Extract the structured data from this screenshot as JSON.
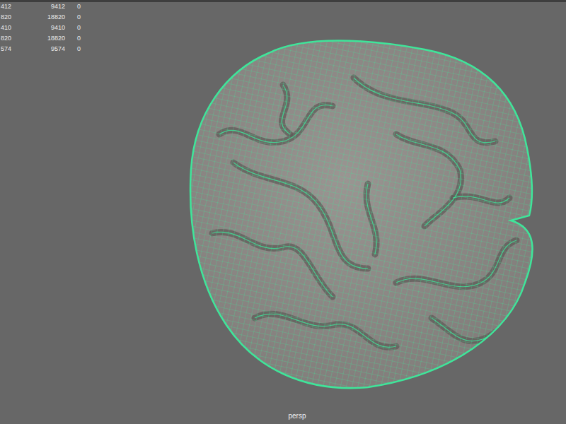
{
  "viewport": {
    "camera": "persp",
    "wireframe_on_shaded": true
  },
  "hud": {
    "poly_count": [
      {
        "cells": [
          "412",
          "9412",
          "0"
        ]
      },
      {
        "cells": [
          "820",
          "18820",
          "0"
        ]
      },
      {
        "cells": [
          "410",
          "9410",
          "0"
        ]
      },
      {
        "cells": [
          "820",
          "18820",
          "0"
        ]
      },
      {
        "cells": [
          "574",
          "9574",
          "0"
        ]
      }
    ]
  }
}
